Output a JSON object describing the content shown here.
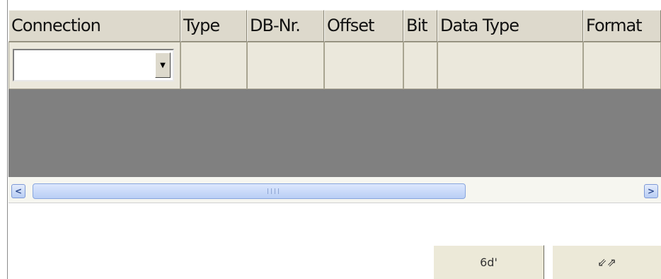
{
  "table": {
    "columns": [
      {
        "label": "Connection"
      },
      {
        "label": "Type"
      },
      {
        "label": "DB-Nr."
      },
      {
        "label": "Offset"
      },
      {
        "label": "Bit"
      },
      {
        "label": "Data Type"
      },
      {
        "label": "Format"
      }
    ],
    "row": {
      "connection_value": "",
      "type": "",
      "db_nr": "",
      "offset": "",
      "bit": "",
      "data_type": "",
      "format": ""
    }
  },
  "scrollbar": {
    "left_arrow": "<",
    "right_arrow": ">"
  },
  "buttons": {
    "view_glyph": "6d'",
    "swap_glyph": "⇙⇗"
  },
  "icons": {
    "dropdown": "chevron-down-icon",
    "view": "glasses-icon",
    "swap": "swap-arrows-icon"
  }
}
